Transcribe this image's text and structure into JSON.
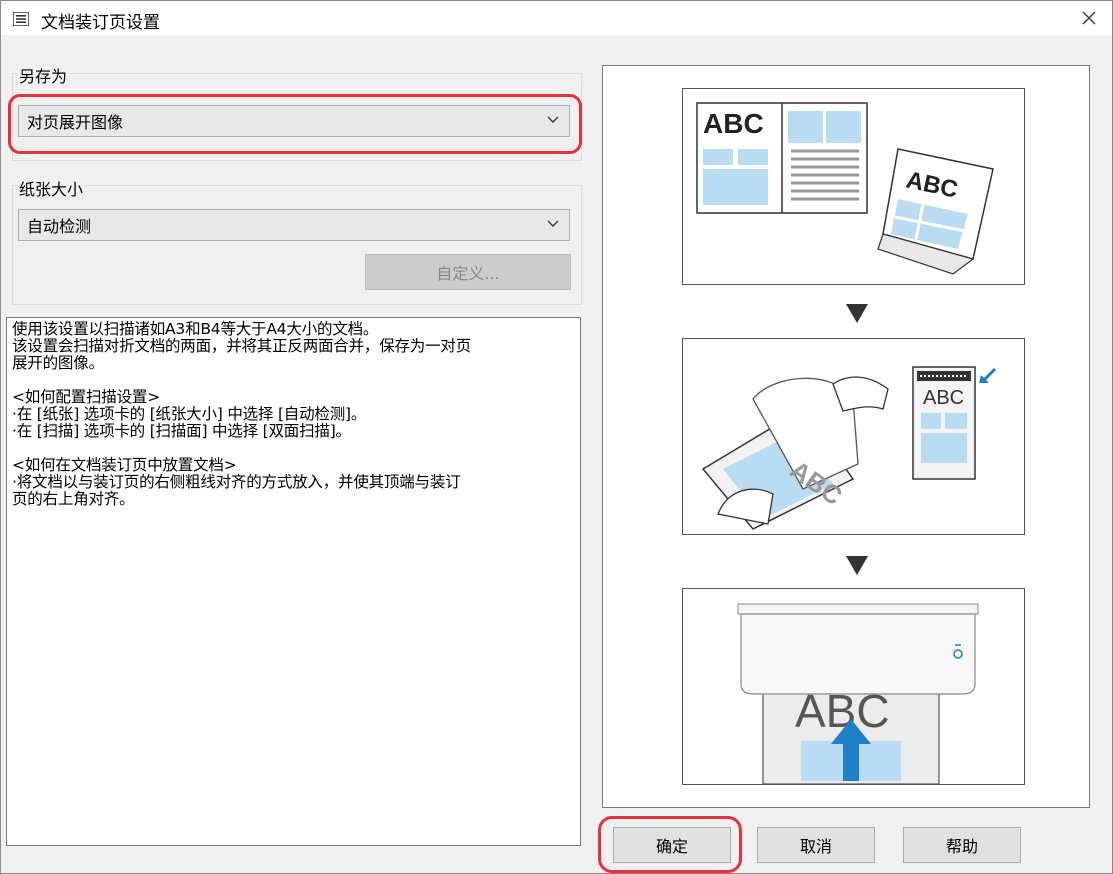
{
  "window": {
    "title": "文档装订页设置"
  },
  "save_as": {
    "group_label": "另存为",
    "selected": "对页展开图像"
  },
  "paper_size": {
    "group_label": "纸张大小",
    "selected": "自动检测",
    "custom_button": "自定义..."
  },
  "description": "使用该设置以扫描诸如A3和B4等大于A4大小的文档。\n该设置会扫描对折文档的两面，并将其正反两面合并，保存为一对页\n展开的图像。\n\n<如何配置扫描设置>\n·在 [纸张] 选项卡的 [纸张大小] 中选择 [自动检测]。\n·在 [扫描] 选项卡的 [扫描面] 中选择 [双面扫描]。\n\n<如何在文档装订页中放置文档>\n·将文档以与装订页的右侧粗线对齐的方式放入，并使其顶端与装订\n页的右上角对齐。",
  "illustration": {
    "abc_text": "ABC"
  },
  "buttons": {
    "ok": "确定",
    "cancel": "取消",
    "help": "帮助"
  },
  "colors": {
    "highlight": "#e8303a",
    "illustration_blue": "#b9dcf2",
    "arrow_blue": "#1f7fc9"
  }
}
